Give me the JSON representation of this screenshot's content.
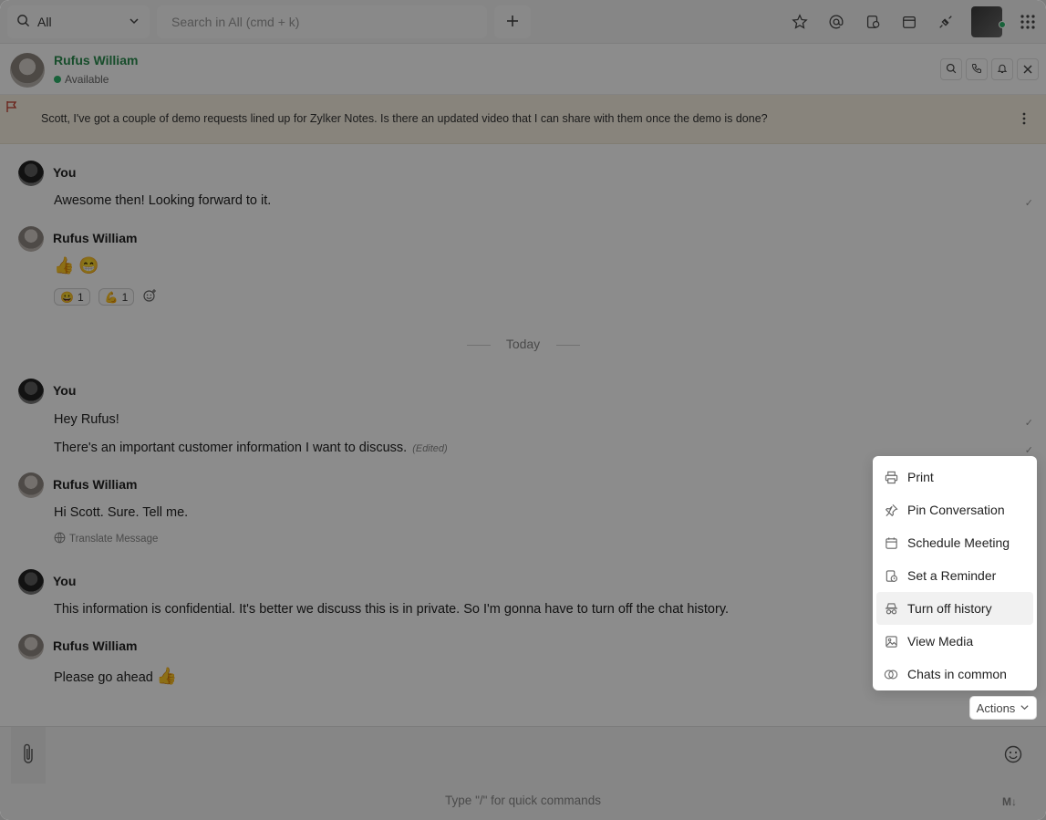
{
  "topbar": {
    "scope_label": "All",
    "search_placeholder": "Search in All (cmd + k)"
  },
  "chat": {
    "contact_name": "Rufus William",
    "contact_status": "Available"
  },
  "pinned": {
    "text": "Scott, I've got a couple of demo requests lined up for Zylker Notes. Is there an updated video that I can share with them once the demo is done?"
  },
  "messages": [
    {
      "sender": "You",
      "lines": [
        "Awesome then! Looking forward to it."
      ]
    },
    {
      "sender": "Rufus William",
      "emojis": "👍 😁",
      "reactions": [
        {
          "emoji": "😀",
          "count": "1"
        },
        {
          "emoji": "💪",
          "count": "1"
        }
      ]
    },
    {
      "sender": "You",
      "lines": [
        "Hey Rufus!",
        "There's an important customer information I want to discuss."
      ],
      "edited": "(Edited)"
    },
    {
      "sender": "Rufus William",
      "lines": [
        "Hi Scott. Sure. Tell me."
      ],
      "translate": "Translate Message"
    },
    {
      "sender": "You",
      "lines": [
        "This information is confidential. It's better we discuss this is in private. So I'm gonna have to turn off the chat history."
      ]
    },
    {
      "sender": "Rufus William",
      "lines": [
        "Please go ahead"
      ],
      "emoji": "👍"
    }
  ],
  "day_separator": "Today",
  "menu": {
    "items": [
      {
        "label": "Print",
        "icon": "printer-icon"
      },
      {
        "label": "Pin Conversation",
        "icon": "pin-icon"
      },
      {
        "label": "Schedule Meeting",
        "icon": "calendar-icon"
      },
      {
        "label": "Set a Reminder",
        "icon": "reminder-icon"
      },
      {
        "label": "Turn off history",
        "icon": "incognito-icon",
        "highlighted": true
      },
      {
        "label": "View Media",
        "icon": "media-icon"
      },
      {
        "label": "Chats in common",
        "icon": "chats-common-icon"
      }
    ]
  },
  "actions_label": "Actions",
  "composer": {
    "hint": "Type \"/\" for quick commands",
    "markdown_label": "M↓"
  },
  "colors": {
    "accent_green": "#2a8c4f",
    "pinned_bg": "#f7f0e2"
  }
}
